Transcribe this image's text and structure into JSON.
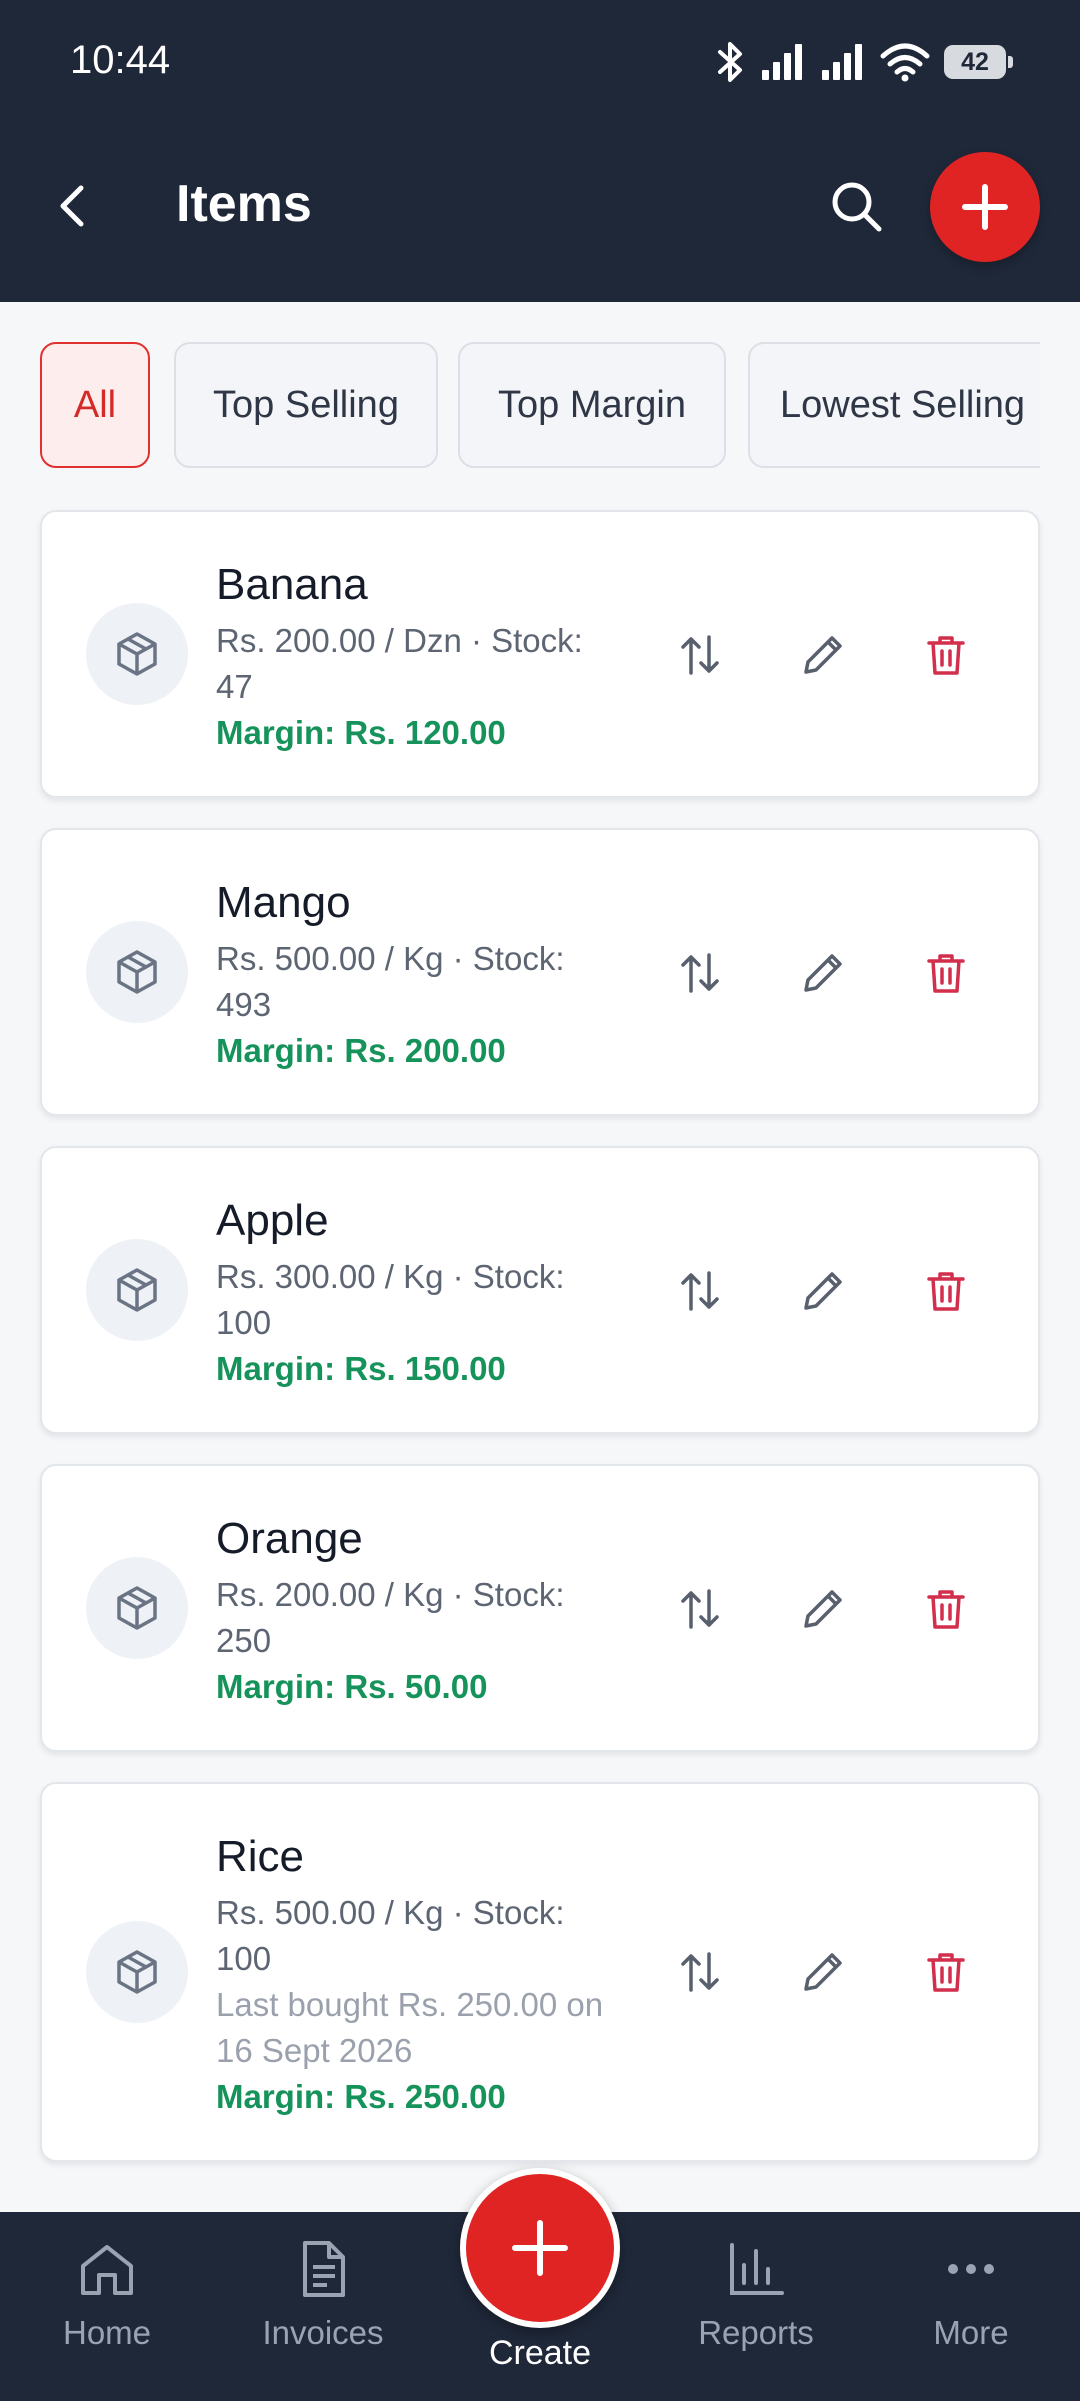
{
  "status_bar": {
    "time": "10:44",
    "battery": "42"
  },
  "header": {
    "title": "Items"
  },
  "filters": [
    {
      "label": "All",
      "active": true
    },
    {
      "label": "Top Selling",
      "active": false
    },
    {
      "label": "Top Margin",
      "active": false
    },
    {
      "label": "Lowest Selling",
      "active": false
    }
  ],
  "items": [
    {
      "name": "Banana",
      "price_stock": "Rs. 200.00 / Dzn  ·  Stock:",
      "stock": "47",
      "last_bought": null,
      "margin": "Margin: Rs. 120.00"
    },
    {
      "name": "Mango",
      "price_stock": "Rs. 500.00 / Kg  ·  Stock:",
      "stock": "493",
      "last_bought": null,
      "margin": "Margin: Rs. 200.00"
    },
    {
      "name": "Apple",
      "price_stock": "Rs. 300.00 / Kg  ·  Stock:",
      "stock": "100",
      "last_bought": null,
      "margin": "Margin: Rs. 150.00"
    },
    {
      "name": "Orange",
      "price_stock": "Rs. 200.00 / Kg  ·  Stock:",
      "stock": "250",
      "last_bought": null,
      "margin": "Margin: Rs. 50.00"
    },
    {
      "name": "Rice",
      "price_stock": "Rs. 500.00 / Kg  ·  Stock:",
      "stock": "100",
      "last_bought": [
        "Last bought Rs. 250.00 on",
        "16 Sept 2026"
      ],
      "margin": "Margin: Rs. 250.00"
    }
  ],
  "item_icons": {
    "avatar": "package-icon",
    "actions": [
      "sort-arrows-icon",
      "pencil-icon",
      "trash-icon"
    ]
  },
  "bottom_nav": {
    "items": [
      {
        "label": "Home",
        "icon": "home-icon"
      },
      {
        "label": "Invoices",
        "icon": "document-icon"
      },
      {
        "label": "Reports",
        "icon": "bar-chart-icon"
      },
      {
        "label": "More",
        "icon": "more-dots-icon"
      }
    ],
    "create_label": "Create"
  },
  "colors": {
    "header_bg": "#1f2839",
    "accent_red": "#e02424",
    "margin_green": "#16935a",
    "delete_red": "#d22f4d",
    "nav_inactive": "#9aa3b2"
  }
}
